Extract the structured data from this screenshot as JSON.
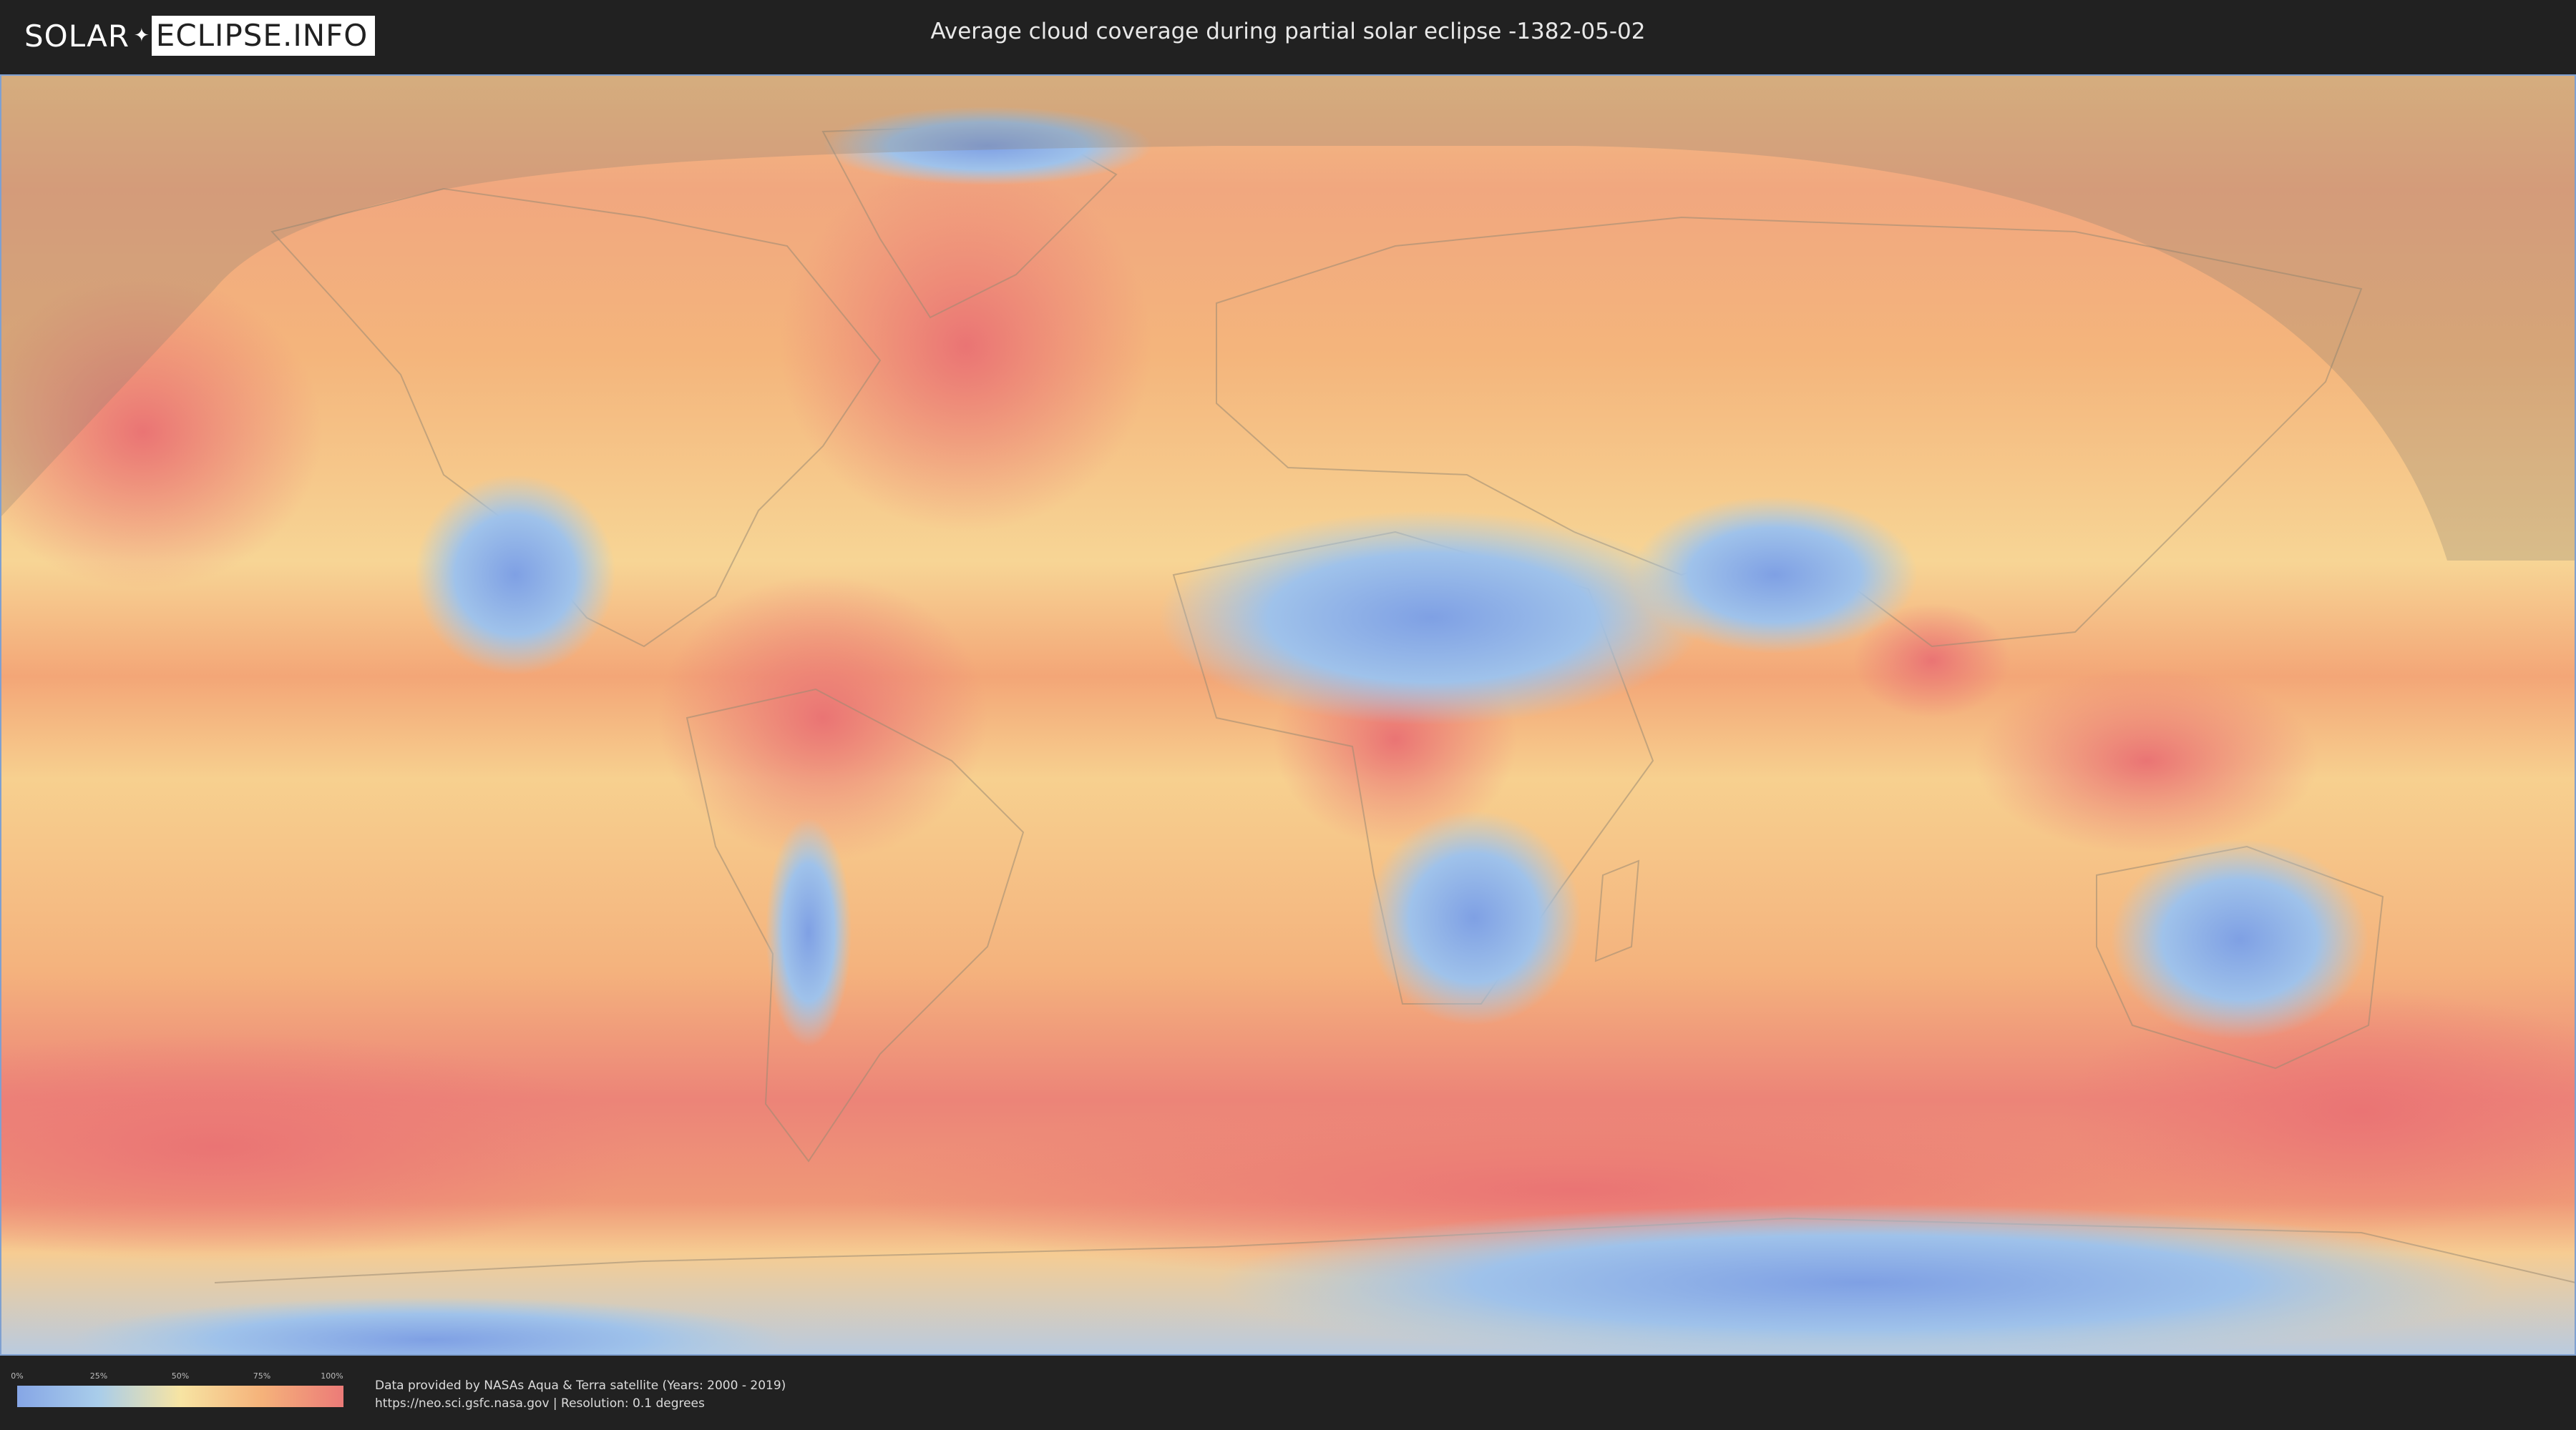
{
  "header": {
    "logo_left": "SOLAR",
    "logo_mark": "✦",
    "logo_right": "ECLIPSE.INFO",
    "title": "Average cloud coverage during partial solar eclipse -1382-05-02"
  },
  "map": {
    "colors": {
      "clear": "#86a6e6",
      "light": "#a9cdea",
      "medium": "#f7e4a3",
      "cloudy": "#f5b27a",
      "overcast": "#ec7b78",
      "eclipse_shade": "#8a7f70"
    }
  },
  "legend": {
    "ticks": [
      "0%",
      "25%",
      "50%",
      "75%",
      "100%"
    ],
    "tick_values": [
      0,
      25,
      50,
      75,
      100
    ]
  },
  "credits": {
    "line1": "Data provided by NASAs Aqua & Terra satellite (Years: 2000 - 2019)",
    "line2": "https://neo.sci.gsfc.nasa.gov | Resolution: 0.1 degrees"
  }
}
